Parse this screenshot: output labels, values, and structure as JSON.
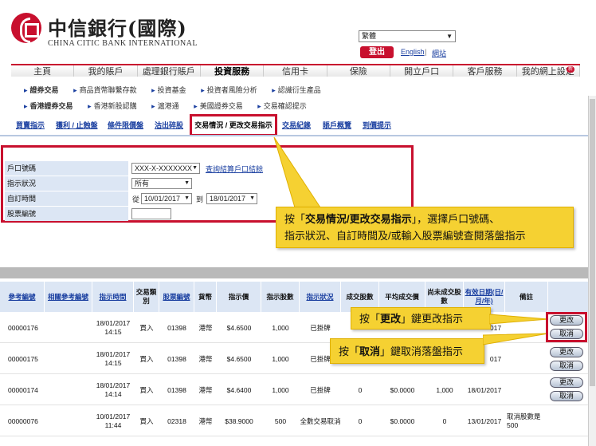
{
  "brand": {
    "name_cn": "中信銀行(國際)",
    "name_en": "CHINA CITIC BANK INTERNATIONAL"
  },
  "header": {
    "lang_select": "繁體",
    "logout": "登出",
    "english": "English",
    "sitemap": "網站"
  },
  "mainnav": [
    "主頁",
    "我的賬戶",
    "處理銀行賬戶",
    "投資服務",
    "信用卡",
    "保險",
    "開立戶口",
    "客戶服務",
    "我的網上設定"
  ],
  "mainnav_active": "投資服務",
  "mainnav_badge": "新",
  "subnav1": [
    "證券交易",
    "商品貨幣聯繫存款",
    "投資基金",
    "投資者風險分析",
    "認識衍生產品"
  ],
  "subnav2": [
    "香港證券交易",
    "香港新股認購",
    "滬港通",
    "美國證券交易",
    "交易確認提示"
  ],
  "tabs": [
    "買賣指示",
    "獲利 / 止蝕盤",
    "條件限價盤",
    "沽出碎股",
    "交易情況 / 更改交易指示",
    "交易紀錄",
    "賬戶概覽",
    "到價提示"
  ],
  "form": {
    "account_label": "戶口號碼",
    "account_value": "XXX-X-XXXXXXX",
    "account_link": "查詢結算戶口結餘",
    "status_label": "指示狀況",
    "status_value": "所有",
    "date_label": "自訂時間",
    "date_from_label": "從",
    "date_from": "10/01/2017",
    "date_to_label": "到",
    "date_to": "18/01/2017",
    "stock_label": "股票編號"
  },
  "callouts": {
    "c1_line1_a": "按「",
    "c1_line1_b": "交易情況/更改交易指示",
    "c1_line1_c": "」，選擇戶口號碼、",
    "c1_line2": "指示狀況、自訂時間及/或輸入股票編號查閱落盤指示",
    "c2_a": "按「",
    "c2_b": "更改",
    "c2_c": "」鍵更改指示",
    "c3_a": "按「",
    "c3_b": "取消",
    "c3_c": "」鍵取消落盤指示"
  },
  "table": {
    "headers": [
      "參考編號",
      "相關參考編號",
      "指示時間",
      "交易類別",
      "股票編號",
      "貨幣",
      "指示價",
      "指示股數",
      "指示狀況",
      "成交股數",
      "平均成交價",
      "尚未成交股數",
      "有效日期(日/月/年)",
      "備註"
    ],
    "rows": [
      {
        "ref": "00000176",
        "rel": "",
        "time": "18/01/2017 14:15",
        "type": "買入",
        "stock": "01398",
        "ccy": "港幣",
        "price": "$4.6500",
        "qty": "1,000",
        "status": "已掛牌",
        "filled": "",
        "avg": "",
        "remain": "",
        "expiry": "017",
        "note": ""
      },
      {
        "ref": "00000175",
        "rel": "",
        "time": "18/01/2017 14:15",
        "type": "買入",
        "stock": "01398",
        "ccy": "港幣",
        "price": "$4.6500",
        "qty": "1,000",
        "status": "已掛牌",
        "filled": "",
        "avg": "",
        "remain": "",
        "expiry": "017",
        "note": ""
      },
      {
        "ref": "00000174",
        "rel": "",
        "time": "18/01/2017 14:14",
        "type": "買入",
        "stock": "01398",
        "ccy": "港幣",
        "price": "$4.6400",
        "qty": "1,000",
        "status": "已掛牌",
        "filled": "0",
        "avg": "$0.0000",
        "remain": "1,000",
        "expiry": "18/01/2017",
        "note": ""
      },
      {
        "ref": "00000076",
        "rel": "",
        "time": "10/01/2017 11:44",
        "type": "買入",
        "stock": "02318",
        "ccy": "港幣",
        "price": "$38.9000",
        "qty": "500",
        "status": "全數交易取消",
        "filled": "0",
        "avg": "$0.0000",
        "remain": "0",
        "expiry": "13/01/2017",
        "note": "取消股數是 500"
      }
    ],
    "btn_amend": "更改",
    "btn_cancel": "取消"
  }
}
